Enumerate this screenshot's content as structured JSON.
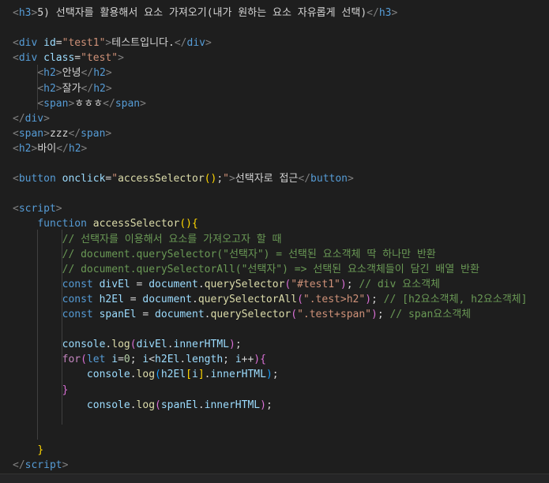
{
  "theme": {
    "background": "#1e1e1e",
    "tag_bracket": "#808080",
    "tag_name": "#569cd6",
    "attr_name": "#9cdcfe",
    "attr_value": "#ce9178",
    "text": "#d4d4d4",
    "keyword": "#569cd6",
    "control": "#c586c0",
    "function": "#dcdcaa",
    "variable": "#9cdcfe",
    "string": "#ce9178",
    "number": "#b5cea8",
    "comment": "#6a9955",
    "bracket1": "#ffd700",
    "bracket2": "#da70d6",
    "bracket3": "#179fff"
  },
  "code_lines": [
    [
      [
        "tag_bracket",
        "<"
      ],
      [
        "tag_name",
        "h3"
      ],
      [
        "tag_bracket",
        ">"
      ],
      [
        "text",
        "5) 선택자를 활용해서 요소 가져오기(내가 원하는 요소 자유롭게 선택)"
      ],
      [
        "tag_bracket",
        "</"
      ],
      [
        "tag_name",
        "h3"
      ],
      [
        "tag_bracket",
        ">"
      ]
    ],
    [],
    [
      [
        "tag_bracket",
        "<"
      ],
      [
        "tag_name",
        "div"
      ],
      [
        "text",
        " "
      ],
      [
        "attr_name",
        "id"
      ],
      [
        "text",
        "="
      ],
      [
        "attr_value",
        "\"test1\""
      ],
      [
        "tag_bracket",
        ">"
      ],
      [
        "text",
        "테스트입니다."
      ],
      [
        "tag_bracket",
        "</"
      ],
      [
        "tag_name",
        "div"
      ],
      [
        "tag_bracket",
        ">"
      ]
    ],
    [
      [
        "tag_bracket",
        "<"
      ],
      [
        "tag_name",
        "div"
      ],
      [
        "text",
        " "
      ],
      [
        "attr_name",
        "class"
      ],
      [
        "text",
        "="
      ],
      [
        "attr_value",
        "\"test\""
      ],
      [
        "tag_bracket",
        ">"
      ]
    ],
    [
      [
        "text",
        "    "
      ],
      [
        "tag_bracket",
        "<"
      ],
      [
        "tag_name",
        "h2"
      ],
      [
        "tag_bracket",
        ">"
      ],
      [
        "text",
        "안녕"
      ],
      [
        "tag_bracket",
        "</"
      ],
      [
        "tag_name",
        "h2"
      ],
      [
        "tag_bracket",
        ">"
      ]
    ],
    [
      [
        "text",
        "    "
      ],
      [
        "tag_bracket",
        "<"
      ],
      [
        "tag_name",
        "h2"
      ],
      [
        "tag_bracket",
        ">"
      ],
      [
        "text",
        "잘가"
      ],
      [
        "tag_bracket",
        "</"
      ],
      [
        "tag_name",
        "h2"
      ],
      [
        "tag_bracket",
        ">"
      ]
    ],
    [
      [
        "text",
        "    "
      ],
      [
        "tag_bracket",
        "<"
      ],
      [
        "tag_name",
        "span"
      ],
      [
        "tag_bracket",
        ">"
      ],
      [
        "text",
        "ㅎㅎㅎ"
      ],
      [
        "tag_bracket",
        "</"
      ],
      [
        "tag_name",
        "span"
      ],
      [
        "tag_bracket",
        ">"
      ]
    ],
    [
      [
        "tag_bracket",
        "</"
      ],
      [
        "tag_name",
        "div"
      ],
      [
        "tag_bracket",
        ">"
      ]
    ],
    [
      [
        "tag_bracket",
        "<"
      ],
      [
        "tag_name",
        "span"
      ],
      [
        "tag_bracket",
        ">"
      ],
      [
        "text",
        "zzz"
      ],
      [
        "tag_bracket",
        "</"
      ],
      [
        "tag_name",
        "span"
      ],
      [
        "tag_bracket",
        ">"
      ]
    ],
    [
      [
        "tag_bracket",
        "<"
      ],
      [
        "tag_name",
        "h2"
      ],
      [
        "tag_bracket",
        ">"
      ],
      [
        "text",
        "바이"
      ],
      [
        "tag_bracket",
        "</"
      ],
      [
        "tag_name",
        "h2"
      ],
      [
        "tag_bracket",
        ">"
      ]
    ],
    [],
    [
      [
        "tag_bracket",
        "<"
      ],
      [
        "tag_name",
        "button"
      ],
      [
        "text",
        " "
      ],
      [
        "attr_name",
        "onclick"
      ],
      [
        "text",
        "="
      ],
      [
        "attr_value",
        "\""
      ],
      [
        "function",
        "accessSelector"
      ],
      [
        "bracket1",
        "()"
      ],
      [
        "text",
        ";"
      ],
      [
        "attr_value",
        "\""
      ],
      [
        "tag_bracket",
        ">"
      ],
      [
        "text",
        "선택자로 접근"
      ],
      [
        "tag_bracket",
        "</"
      ],
      [
        "tag_name",
        "button"
      ],
      [
        "tag_bracket",
        ">"
      ]
    ],
    [],
    [
      [
        "tag_bracket",
        "<"
      ],
      [
        "tag_name",
        "script"
      ],
      [
        "tag_bracket",
        ">"
      ]
    ],
    [
      [
        "text",
        "    "
      ],
      [
        "keyword",
        "function"
      ],
      [
        "text",
        " "
      ],
      [
        "function",
        "accessSelector"
      ],
      [
        "bracket1",
        "(){"
      ]
    ],
    [
      [
        "text",
        "        "
      ],
      [
        "comment",
        "// 선택자를 이용해서 요소를 가져오고자 할 때"
      ]
    ],
    [
      [
        "text",
        "        "
      ],
      [
        "comment",
        "// document.querySelector(\"선택자\") = 선택된 요소객체 딱 하나만 반환"
      ]
    ],
    [
      [
        "text",
        "        "
      ],
      [
        "comment",
        "// document.querySelectorAll(\"선택자\") => 선택된 요소객체들이 담긴 배열 반환"
      ]
    ],
    [
      [
        "text",
        "        "
      ],
      [
        "keyword",
        "const"
      ],
      [
        "text",
        " "
      ],
      [
        "variable",
        "divEl"
      ],
      [
        "text",
        " = "
      ],
      [
        "variable",
        "document"
      ],
      [
        "text",
        "."
      ],
      [
        "function",
        "querySelector"
      ],
      [
        "bracket2",
        "("
      ],
      [
        "string",
        "\"#test1\""
      ],
      [
        "bracket2",
        ")"
      ],
      [
        "text",
        "; "
      ],
      [
        "comment",
        "// div 요소객체"
      ]
    ],
    [
      [
        "text",
        "        "
      ],
      [
        "keyword",
        "const"
      ],
      [
        "text",
        " "
      ],
      [
        "variable",
        "h2El"
      ],
      [
        "text",
        " = "
      ],
      [
        "variable",
        "document"
      ],
      [
        "text",
        "."
      ],
      [
        "function",
        "querySelectorAll"
      ],
      [
        "bracket2",
        "("
      ],
      [
        "string",
        "\".test>h2\""
      ],
      [
        "bracket2",
        ")"
      ],
      [
        "text",
        "; "
      ],
      [
        "comment",
        "// [h2요소객체, h2요소객체]"
      ]
    ],
    [
      [
        "text",
        "        "
      ],
      [
        "keyword",
        "const"
      ],
      [
        "text",
        " "
      ],
      [
        "variable",
        "spanEl"
      ],
      [
        "text",
        " = "
      ],
      [
        "variable",
        "document"
      ],
      [
        "text",
        "."
      ],
      [
        "function",
        "querySelector"
      ],
      [
        "bracket2",
        "("
      ],
      [
        "string",
        "\".test+span\""
      ],
      [
        "bracket2",
        ")"
      ],
      [
        "text",
        "; "
      ],
      [
        "comment",
        "// span요소객체"
      ]
    ],
    [],
    [
      [
        "text",
        "        "
      ],
      [
        "variable",
        "console"
      ],
      [
        "text",
        "."
      ],
      [
        "function",
        "log"
      ],
      [
        "bracket2",
        "("
      ],
      [
        "variable",
        "divEl"
      ],
      [
        "text",
        "."
      ],
      [
        "variable",
        "innerHTML"
      ],
      [
        "bracket2",
        ")"
      ],
      [
        "text",
        ";"
      ]
    ],
    [
      [
        "text",
        "        "
      ],
      [
        "control",
        "for"
      ],
      [
        "bracket2",
        "("
      ],
      [
        "keyword",
        "let"
      ],
      [
        "text",
        " "
      ],
      [
        "variable",
        "i"
      ],
      [
        "text",
        "="
      ],
      [
        "number",
        "0"
      ],
      [
        "text",
        "; "
      ],
      [
        "variable",
        "i"
      ],
      [
        "text",
        "<"
      ],
      [
        "variable",
        "h2El"
      ],
      [
        "text",
        "."
      ],
      [
        "variable",
        "length"
      ],
      [
        "text",
        "; "
      ],
      [
        "variable",
        "i"
      ],
      [
        "text",
        "++"
      ],
      [
        "bracket2",
        ")"
      ],
      [
        "bracket2",
        "{"
      ]
    ],
    [
      [
        "text",
        "            "
      ],
      [
        "variable",
        "console"
      ],
      [
        "text",
        "."
      ],
      [
        "function",
        "log"
      ],
      [
        "bracket3",
        "("
      ],
      [
        "variable",
        "h2El"
      ],
      [
        "bracket1",
        "["
      ],
      [
        "variable",
        "i"
      ],
      [
        "bracket1",
        "]"
      ],
      [
        "text",
        "."
      ],
      [
        "variable",
        "innerHTML"
      ],
      [
        "bracket3",
        ")"
      ],
      [
        "text",
        ";"
      ]
    ],
    [
      [
        "text",
        "        "
      ],
      [
        "bracket2",
        "}"
      ]
    ],
    [
      [
        "text",
        "            "
      ],
      [
        "variable",
        "console"
      ],
      [
        "text",
        "."
      ],
      [
        "function",
        "log"
      ],
      [
        "bracket2",
        "("
      ],
      [
        "variable",
        "spanEl"
      ],
      [
        "text",
        "."
      ],
      [
        "variable",
        "innerHTML"
      ],
      [
        "bracket2",
        ")"
      ],
      [
        "text",
        ";"
      ]
    ],
    [],
    [],
    [
      [
        "text",
        "    "
      ],
      [
        "bracket1",
        "}"
      ]
    ],
    [
      [
        "tag_bracket",
        "</"
      ],
      [
        "tag_name",
        "script"
      ],
      [
        "tag_bracket",
        ">"
      ]
    ]
  ]
}
